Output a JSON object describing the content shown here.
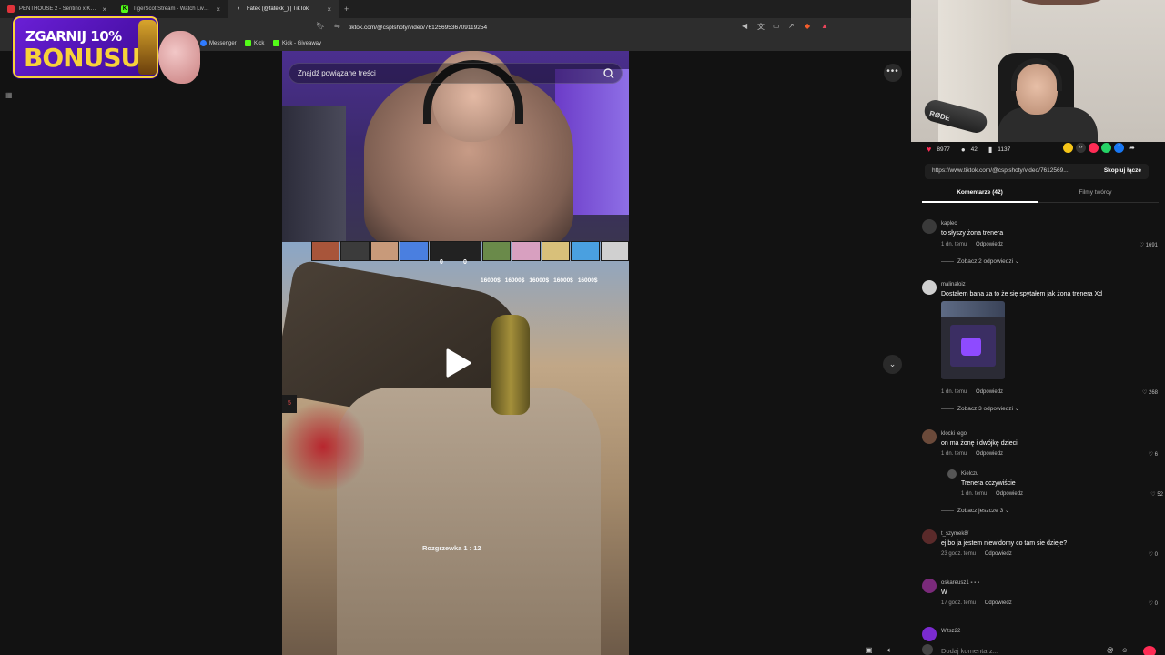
{
  "browser": {
    "tabs": [
      {
        "title": "PENTHOUSE 2 - Sentino x Koneser >",
        "favicon_color": "#e0333a"
      },
      {
        "title": "TigerScot Stream - Watch Live on Kick",
        "favicon_color": "#53fc18"
      },
      {
        "title": "Fatek (@fatekk_) | TikTok",
        "favicon_color": "#ffffff",
        "active": true
      }
    ],
    "new_tab": "+",
    "url": "tiktok.com/@csplshoty/video/7612569536709119254",
    "bookmarks": [
      {
        "label": "Messenger",
        "color": "#2f7bff"
      },
      {
        "label": "Kick",
        "color": "#53fc18"
      },
      {
        "label": "Kick - Giveaway",
        "color": "#53fc18"
      }
    ],
    "bookmark_fragment": "s"
  },
  "promo": {
    "line1": "ZGARNIJ 10%",
    "line2": "BONUSU"
  },
  "video": {
    "search_placeholder": "Znajdź powiązane treści",
    "money": [
      "16000$",
      "16000$",
      "16000$",
      "16000$",
      "16000$"
    ],
    "score_left": "0",
    "score_right": "0",
    "warmup": "Rozgrzewka 1 : 12",
    "side_number": "5",
    "more": "•••"
  },
  "stats": {
    "likes": "8977",
    "comments": "42",
    "saves": "1137"
  },
  "link": {
    "url": "https://www.tiktok.com/@csplshoty/video/7612569...",
    "copy": "Skopiuj łącze"
  },
  "tabs": {
    "comments": "Komentarze (42)",
    "creator": "Filmy twórcy"
  },
  "comments": [
    {
      "user": "kaplec",
      "text": "to słyszy żona trenera",
      "time": "1 dn. temu",
      "reply": "Odpowiedz",
      "likes": "1691",
      "more": "Zobacz 2 odpowiedzi",
      "avatar": "#3a3a3a"
    },
    {
      "user": "malinaloiz",
      "text": "Dostałem bana za to że się spytałem jak żona trenera Xd",
      "time": "1 dn. temu",
      "reply": "Odpowiedz",
      "likes": "268",
      "more": "Zobacz 3 odpowiedzi",
      "avatar": "#cfcfcf"
    },
    {
      "user": "klocki lego",
      "text": "on ma żonę i dwójkę dzieci",
      "time": "1 dn. temu",
      "reply": "Odpowiedz",
      "likes": "6",
      "more": "Zobacz jeszcze 3",
      "avatar": "#6b4a3a",
      "sub": {
        "user": "Kielczu",
        "text": "Trenera oczywiście",
        "time": "1 dn. temu",
        "reply": "Odpowiedz",
        "likes": "52"
      }
    },
    {
      "user": "t_szymek8/",
      "text": "ej bo ja jestem niewidomy co tam sie dzieje?",
      "time": "23 godz. temu",
      "reply": "Odpowiedz",
      "likes": "0",
      "avatar": "#5a2a2a"
    },
    {
      "user": "oskareusz1",
      "text": "W",
      "time": "17 godz. temu",
      "reply": "Odpowiedz",
      "likes": "0",
      "avatar": "#7a2a7a"
    },
    {
      "user": "Witsz22",
      "avatar": "#7b2bd0"
    }
  ],
  "composer": {
    "placeholder": "Dodaj komentarz..."
  }
}
